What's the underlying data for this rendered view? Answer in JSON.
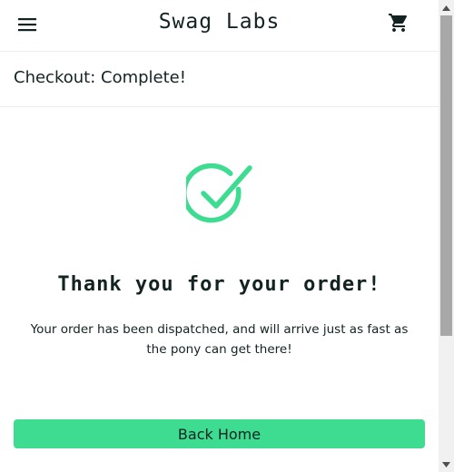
{
  "header": {
    "app_title": "Swag Labs",
    "menu_icon": "hamburger-menu-icon",
    "cart_icon": "shopping-cart-icon"
  },
  "subheader": {
    "title": "Checkout: Complete!"
  },
  "main": {
    "success_icon": "checkmark-circle-icon",
    "complete_header": "Thank you for your order!",
    "complete_text": "Your order has been dispatched, and will arrive just as fast as the pony can get there!",
    "back_button_label": "Back Home"
  },
  "colors": {
    "accent": "#3ddc91",
    "text": "#132322",
    "divider": "#ededef"
  }
}
